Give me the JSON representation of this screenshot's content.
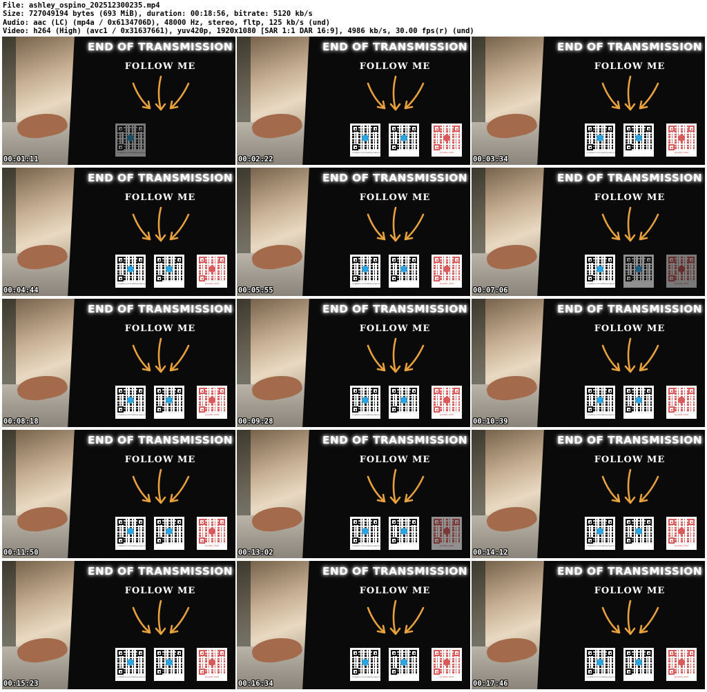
{
  "header": {
    "file_line": "File: ashley_ospino_202512300235.mp4",
    "size_line": "Size: 727049194 bytes (693 MiB), duration: 00:18:56, bitrate: 5120 kb/s",
    "audio_line": "Audio: aac (LC) (mp4a / 0x6134706D), 48000 Hz, stereo, fltp, 125 kb/s (und)",
    "video_line": "Video: h264 (High) (avc1 / 0x31637661), yuv420p, 1920x1080 [SAR 1:1 DAR 16:9], 4986 kb/s, 30.00 fps(r) (und)"
  },
  "frame_text": {
    "title": "END OF TRANSMISSION",
    "follow": "FOLLOW ME",
    "qr_caption_1": "onlyfans.com/ashleyospino",
    "qr_caption_3": "@ALWR_0935"
  },
  "colors": {
    "arrow": "#e8a13c",
    "telegram_badge": "#2ba4e0",
    "instagram_badge": "#d85a5a",
    "tile_background": "#0a0a0a"
  },
  "icons": [
    "telegram-icon",
    "instagram-icon"
  ],
  "frames": [
    {
      "timestamp": "00:01:11",
      "qr": [
        "dim"
      ]
    },
    {
      "timestamp": "00:02:22",
      "qr": [
        "full",
        "full",
        "full"
      ]
    },
    {
      "timestamp": "00:03:34",
      "qr": [
        "full",
        "full",
        "full"
      ]
    },
    {
      "timestamp": "00:04:44",
      "qr": [
        "full",
        "full",
        "full"
      ]
    },
    {
      "timestamp": "00:05:55",
      "qr": [
        "full",
        "full",
        "full"
      ]
    },
    {
      "timestamp": "00:07:06",
      "qr": [
        "full",
        "faded",
        "dim"
      ]
    },
    {
      "timestamp": "00:08:18",
      "qr": [
        "full",
        "full",
        "full"
      ]
    },
    {
      "timestamp": "00:09:28",
      "qr": [
        "full",
        "full",
        "full"
      ]
    },
    {
      "timestamp": "00:10:39",
      "qr": [
        "full",
        "full",
        "full"
      ]
    },
    {
      "timestamp": "00:11:50",
      "qr": [
        "full",
        "full",
        "full"
      ]
    },
    {
      "timestamp": "00:13:02",
      "qr": [
        "full",
        "full",
        "faded"
      ]
    },
    {
      "timestamp": "00:14:12",
      "qr": [
        "full",
        "full",
        "full"
      ]
    },
    {
      "timestamp": "00:15:23",
      "qr": [
        "full",
        "full",
        "full"
      ]
    },
    {
      "timestamp": "00:16:34",
      "qr": [
        "full",
        "full",
        "full"
      ]
    },
    {
      "timestamp": "00:17:46",
      "qr": [
        "full",
        "full",
        "full"
      ]
    }
  ]
}
